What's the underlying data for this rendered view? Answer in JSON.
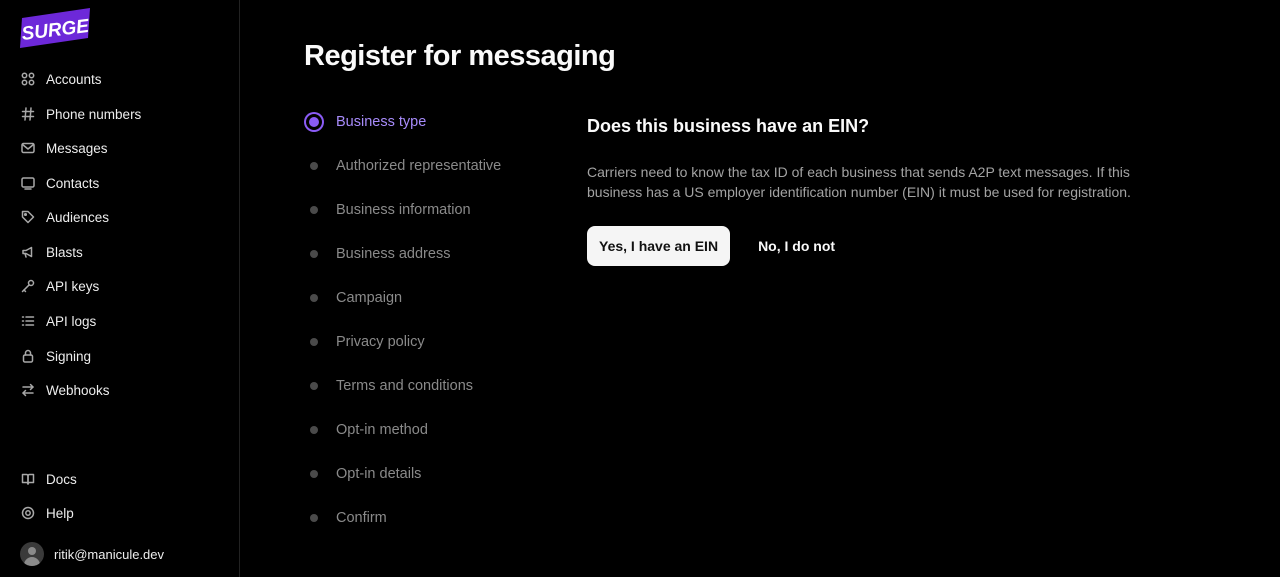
{
  "brand": {
    "name": "SURGE",
    "color": "#6d28d9"
  },
  "sidebar": {
    "items": [
      {
        "label": "Accounts",
        "icon": "accounts-icon"
      },
      {
        "label": "Phone numbers",
        "icon": "hash-icon"
      },
      {
        "label": "Messages",
        "icon": "envelope-icon"
      },
      {
        "label": "Contacts",
        "icon": "contact-card-icon"
      },
      {
        "label": "Audiences",
        "icon": "tag-icon"
      },
      {
        "label": "Blasts",
        "icon": "megaphone-icon"
      },
      {
        "label": "API keys",
        "icon": "key-icon"
      },
      {
        "label": "API logs",
        "icon": "list-icon"
      },
      {
        "label": "Signing",
        "icon": "lock-icon"
      },
      {
        "label": "Webhooks",
        "icon": "arrows-exchange-icon"
      }
    ],
    "bottom_items": [
      {
        "label": "Docs",
        "icon": "book-icon"
      },
      {
        "label": "Help",
        "icon": "help-icon"
      }
    ],
    "user": {
      "email": "ritik@manicule.dev"
    }
  },
  "main": {
    "title": "Register for messaging",
    "steps": [
      {
        "label": "Business type",
        "active": true
      },
      {
        "label": "Authorized representative",
        "active": false
      },
      {
        "label": "Business information",
        "active": false
      },
      {
        "label": "Business address",
        "active": false
      },
      {
        "label": "Campaign",
        "active": false
      },
      {
        "label": "Privacy policy",
        "active": false
      },
      {
        "label": "Terms and conditions",
        "active": false
      },
      {
        "label": "Opt-in method",
        "active": false
      },
      {
        "label": "Opt-in details",
        "active": false
      },
      {
        "label": "Confirm",
        "active": false
      }
    ],
    "question": "Does this business have an EIN?",
    "description": "Carriers need to know the tax ID of each business that sends A2P text messages. If this business has a US employer identification number (EIN) it must be used for registration.",
    "yes_label": "Yes, I have an EIN",
    "no_label": "No, I do not"
  },
  "colors": {
    "accent": "#8b5cf6",
    "active_step_text": "#a78bfa"
  }
}
